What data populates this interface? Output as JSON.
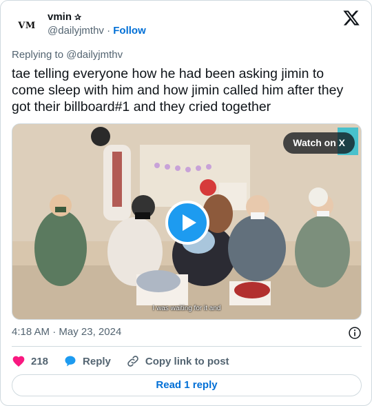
{
  "author": {
    "avatar_text": "VM",
    "display_name": "vmin",
    "name_emoji": "✰",
    "handle": "@dailyjmthv",
    "separator": "·",
    "follow_label": "Follow"
  },
  "icons": {
    "brand": "x-logo-icon",
    "play": "play-icon",
    "info": "info-icon",
    "like": "heart-icon",
    "reply": "reply-bubble-icon",
    "copy": "link-icon"
  },
  "reply_context": {
    "prefix": "Replying to",
    "handle": "@dailyjmthv"
  },
  "tweet": {
    "text": "tae telling everyone how he had been asking jimin to come sleep with him and how jimin called him after they got their billboard#1 and they cried together"
  },
  "media": {
    "watch_label": "Watch on X",
    "subtitle": "I was waiting for it and"
  },
  "meta": {
    "time": "4:18 AM",
    "dot": "·",
    "date": "May 23, 2024"
  },
  "actions": {
    "like_count": "218",
    "reply_label": "Reply",
    "copy_label": "Copy link to post"
  },
  "footer": {
    "read_replies": "Read 1 reply"
  },
  "colors": {
    "link_blue": "#006fd6",
    "play_blue": "#1d9bf0",
    "heart_pink": "#f91880",
    "muted": "#536471",
    "border": "#cfd9de"
  }
}
